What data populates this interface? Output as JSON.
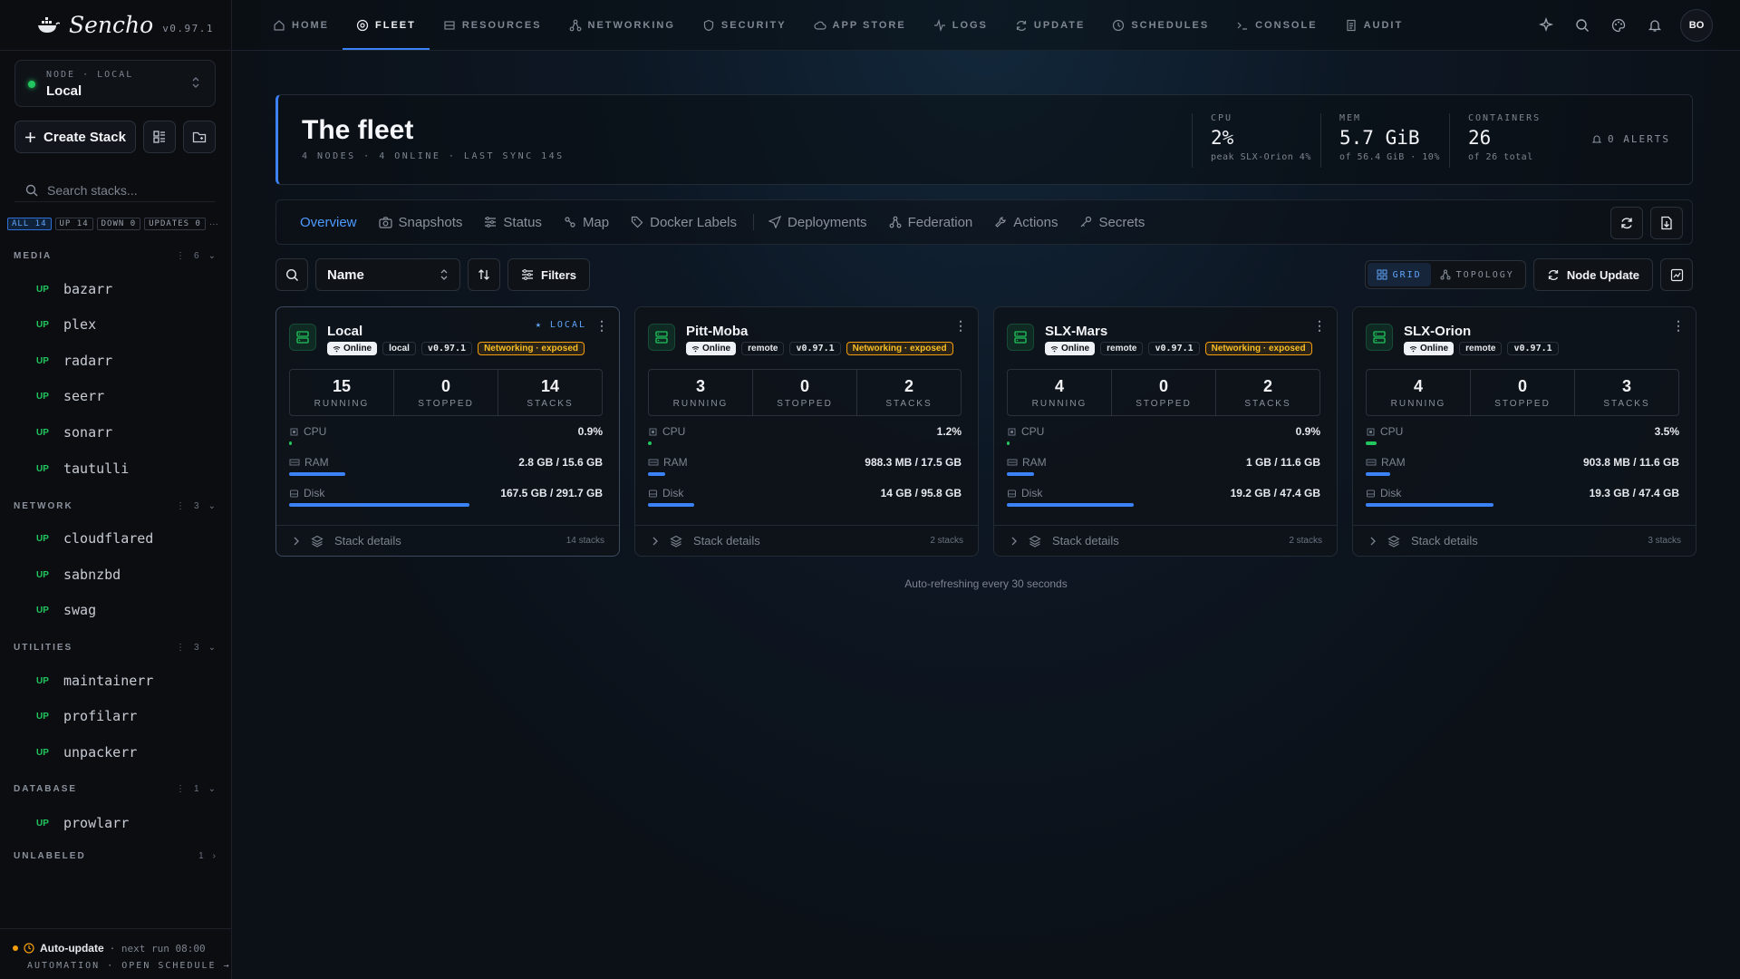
{
  "app": {
    "name": "Sencho",
    "version": "v0.97.1"
  },
  "node_selector": {
    "label": "NODE · LOCAL",
    "value": "Local"
  },
  "sidebar": {
    "create_label": "Create Stack",
    "search_placeholder": "Search stacks...",
    "filters": [
      {
        "label": "ALL 14",
        "active": true
      },
      {
        "label": "UP 14",
        "active": false
      },
      {
        "label": "DOWN 0",
        "active": false
      },
      {
        "label": "UPDATES 0",
        "active": false
      }
    ],
    "more": "···",
    "groups": [
      {
        "name": "MEDIA",
        "count": "6",
        "items": [
          {
            "status": "UP",
            "name": "bazarr"
          },
          {
            "status": "UP",
            "name": "plex"
          },
          {
            "status": "UP",
            "name": "radarr"
          },
          {
            "status": "UP",
            "name": "seerr"
          },
          {
            "status": "UP",
            "name": "sonarr"
          },
          {
            "status": "UP",
            "name": "tautulli"
          }
        ]
      },
      {
        "name": "NETWORK",
        "count": "3",
        "items": [
          {
            "status": "UP",
            "name": "cloudflared"
          },
          {
            "status": "UP",
            "name": "sabnzbd"
          },
          {
            "status": "UP",
            "name": "swag"
          }
        ]
      },
      {
        "name": "UTILITIES",
        "count": "3",
        "items": [
          {
            "status": "UP",
            "name": "maintainerr"
          },
          {
            "status": "UP",
            "name": "profilarr"
          },
          {
            "status": "UP",
            "name": "unpackerr"
          }
        ]
      },
      {
        "name": "DATABASE",
        "count": "1",
        "items": [
          {
            "status": "UP",
            "name": "prowlarr"
          }
        ]
      },
      {
        "name": "UNLABELED",
        "count": "1",
        "items": []
      }
    ],
    "footer": {
      "title": "Auto-update",
      "next": "· next run 08:00",
      "link": "AUTOMATION · OPEN SCHEDULE →"
    }
  },
  "nav": {
    "items": [
      {
        "label": "HOME",
        "icon": "home-icon",
        "active": false
      },
      {
        "label": "FLEET",
        "icon": "fleet-icon",
        "active": true
      },
      {
        "label": "RESOURCES",
        "icon": "resources-icon",
        "active": false
      },
      {
        "label": "NETWORKING",
        "icon": "networking-icon",
        "active": false
      },
      {
        "label": "SECURITY",
        "icon": "shield-icon",
        "active": false
      },
      {
        "label": "APP STORE",
        "icon": "cloud-icon",
        "active": false
      },
      {
        "label": "LOGS",
        "icon": "activity-icon",
        "active": false
      },
      {
        "label": "UPDATE",
        "icon": "refresh-icon",
        "active": false
      },
      {
        "label": "SCHEDULES",
        "icon": "clock-icon",
        "active": false
      },
      {
        "label": "CONSOLE",
        "icon": "terminal-icon",
        "active": false
      },
      {
        "label": "AUDIT",
        "icon": "audit-icon",
        "active": false
      }
    ],
    "avatar": "BO"
  },
  "hero": {
    "title": "The fleet",
    "subtitle": "4 NODES · 4 ONLINE · LAST SYNC 14S",
    "stats": [
      {
        "label": "CPU",
        "value": "2%",
        "sub": "peak SLX-Orion 4%"
      },
      {
        "label": "MEM",
        "value": "5.7 GiB",
        "sub": "of 56.4 GiB · 10%"
      },
      {
        "label": "CONTAINERS",
        "value": "26",
        "sub": "of 26 total"
      }
    ],
    "alerts": "0 ALERTS"
  },
  "tabs": [
    {
      "label": "Overview",
      "icon": "overview-icon",
      "active": true
    },
    {
      "label": "Snapshots",
      "icon": "camera-icon",
      "active": false
    },
    {
      "label": "Status",
      "icon": "sliders-icon",
      "active": false
    },
    {
      "label": "Map",
      "icon": "map-icon",
      "active": false
    },
    {
      "label": "Docker Labels",
      "icon": "tag-icon",
      "active": false
    },
    {
      "label": "Deployments",
      "icon": "send-icon",
      "active": false
    },
    {
      "label": "Federation",
      "icon": "federation-icon",
      "active": false
    },
    {
      "label": "Actions",
      "icon": "wrench-icon",
      "active": false
    },
    {
      "label": "Secrets",
      "icon": "key-icon",
      "active": false
    }
  ],
  "toolbar": {
    "sort_value": "Name",
    "filters_label": "Filters",
    "view_grid": "GRID",
    "view_topology": "TOPOLOGY",
    "node_update": "Node Update"
  },
  "nodes": [
    {
      "name": "Local",
      "is_local": true,
      "local_tag": "★ LOCAL",
      "status": "Online",
      "type": "local",
      "version": "v0.97.1",
      "net_exposed": "Networking · exposed",
      "running": "15",
      "stopped": "0",
      "stacks": "14",
      "cpu": "0.9%",
      "cpu_fraction": 0.009,
      "ram": "2.8 GB / 15.6 GB",
      "ram_fraction": 0.18,
      "disk": "167.5 GB / 291.7 GB",
      "disk_fraction": 0.574,
      "footer": "Stack details",
      "footer_count": "14 stacks"
    },
    {
      "name": "Pitt-Moba",
      "is_local": false,
      "status": "Online",
      "type": "remote",
      "version": "v0.97.1",
      "net_exposed": "Networking · exposed",
      "running": "3",
      "stopped": "0",
      "stacks": "2",
      "cpu": "1.2%",
      "cpu_fraction": 0.012,
      "ram": "988.3 MB / 17.5 GB",
      "ram_fraction": 0.056,
      "disk": "14 GB / 95.8 GB",
      "disk_fraction": 0.146,
      "footer": "Stack details",
      "footer_count": "2 stacks"
    },
    {
      "name": "SLX-Mars",
      "is_local": false,
      "status": "Online",
      "type": "remote",
      "version": "v0.97.1",
      "net_exposed": "Networking · exposed",
      "running": "4",
      "stopped": "0",
      "stacks": "2",
      "cpu": "0.9%",
      "cpu_fraction": 0.009,
      "ram": "1 GB / 11.6 GB",
      "ram_fraction": 0.086,
      "disk": "19.2 GB / 47.4 GB",
      "disk_fraction": 0.405,
      "footer": "Stack details",
      "footer_count": "2 stacks"
    },
    {
      "name": "SLX-Orion",
      "is_local": false,
      "status": "Online",
      "type": "remote",
      "version": "v0.97.1",
      "net_exposed": "",
      "running": "4",
      "stopped": "0",
      "stacks": "3",
      "cpu": "3.5%",
      "cpu_fraction": 0.035,
      "ram": "903.8 MB / 11.6 GB",
      "ram_fraction": 0.078,
      "disk": "19.3 GB / 47.4 GB",
      "disk_fraction": 0.407,
      "footer": "Stack details",
      "footer_count": "3 stacks"
    }
  ],
  "labels": {
    "running": "RUNNING",
    "stopped": "STOPPED",
    "stacks": "STACKS",
    "cpu": "CPU",
    "ram": "RAM",
    "disk": "Disk"
  },
  "auto_refresh": "Auto-refreshing every 30 seconds",
  "colors": {
    "accent": "#3b82f6",
    "online": "#22c55e",
    "warning": "#f59e0b"
  }
}
